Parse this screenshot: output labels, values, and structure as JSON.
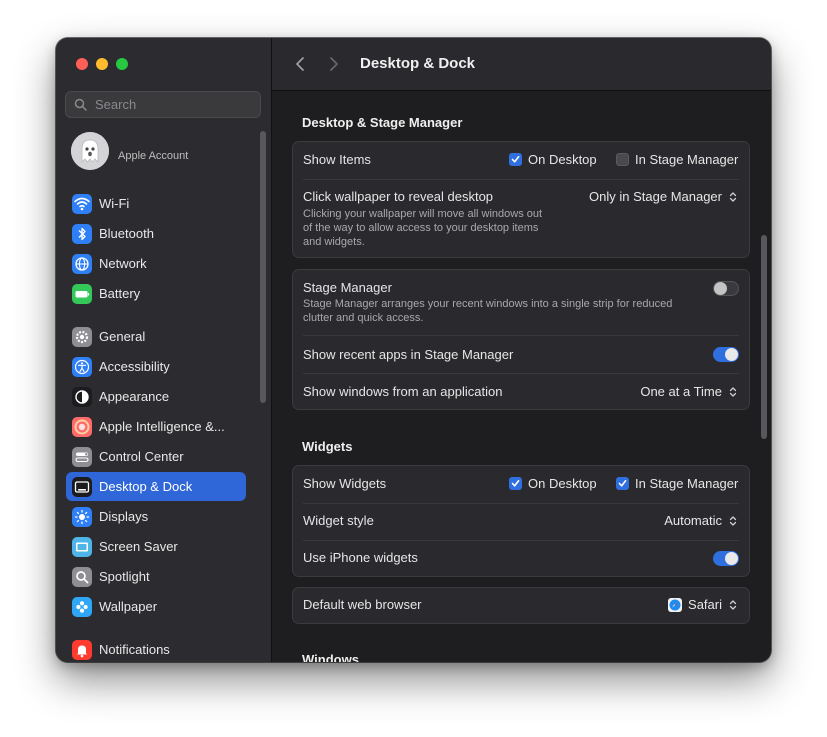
{
  "sidebar": {
    "search_placeholder": "Search",
    "account_label": "Apple Account",
    "items": [
      {
        "label": "Wi-Fi",
        "icon": "wifi-icon",
        "color": "#2f7ff6"
      },
      {
        "label": "Bluetooth",
        "icon": "bluetooth-icon",
        "color": "#2f7ff6"
      },
      {
        "label": "Network",
        "icon": "globe-icon",
        "color": "#2f7ff6"
      },
      {
        "label": "Battery",
        "icon": "battery-icon",
        "color": "#34c759"
      },
      {
        "label": "General",
        "icon": "gear-icon",
        "color": "#8e8e93"
      },
      {
        "label": "Accessibility",
        "icon": "accessibility-icon",
        "color": "#2f7ff6"
      },
      {
        "label": "Appearance",
        "icon": "appearance-icon",
        "color": "#1c1c1e"
      },
      {
        "label": "Apple Intelligence &...",
        "icon": "apple-intelligence-icon",
        "color": "#ff6b6b"
      },
      {
        "label": "Control Center",
        "icon": "control-center-icon",
        "color": "#8e8e93"
      },
      {
        "label": "Desktop & Dock",
        "icon": "desktop-dock-icon",
        "color": "#1c1c1e",
        "active": true
      },
      {
        "label": "Displays",
        "icon": "displays-icon",
        "color": "#2f7ff6"
      },
      {
        "label": "Screen Saver",
        "icon": "screen-saver-icon",
        "color": "#4fb4e8"
      },
      {
        "label": "Spotlight",
        "icon": "spotlight-icon",
        "color": "#8e8e93"
      },
      {
        "label": "Wallpaper",
        "icon": "wallpaper-icon",
        "color": "#2fa7f6"
      },
      {
        "label": "Notifications",
        "icon": "notifications-icon",
        "color": "#ff3b30"
      }
    ]
  },
  "header": {
    "title": "Desktop & Dock"
  },
  "sections": {
    "desktop_stage": {
      "title": "Desktop & Stage Manager",
      "show_items": {
        "label": "Show Items",
        "on_desktop": {
          "label": "On Desktop",
          "checked": true
        },
        "in_stage_manager": {
          "label": "In Stage Manager",
          "checked": false
        }
      },
      "click_wallpaper": {
        "label": "Click wallpaper to reveal desktop",
        "value": "Only in Stage Manager",
        "desc_line1": "Clicking your wallpaper will move all windows out",
        "desc_line2": "of the way to allow access to your desktop items",
        "desc_line3": "and widgets."
      },
      "stage_manager": {
        "label": "Stage Manager",
        "enabled": false,
        "desc_line1": "Stage Manager arranges your recent windows into a single strip for reduced",
        "desc_line2": "clutter and quick access."
      },
      "recent_apps": {
        "label": "Show recent apps in Stage Manager",
        "enabled": true
      },
      "windows_from_app": {
        "label": "Show windows from an application",
        "value": "One at a Time"
      }
    },
    "widgets": {
      "title": "Widgets",
      "show_widgets": {
        "label": "Show Widgets",
        "on_desktop": {
          "label": "On Desktop",
          "checked": true
        },
        "in_stage_manager": {
          "label": "In Stage Manager",
          "checked": true
        }
      },
      "widget_style": {
        "label": "Widget style",
        "value": "Automatic"
      },
      "iphone_widgets": {
        "label": "Use iPhone widgets",
        "enabled": true
      }
    },
    "browser": {
      "label": "Default web browser",
      "value": "Safari"
    },
    "windows": {
      "title": "Windows"
    }
  },
  "colors": {
    "accent": "#2f6fe0",
    "sidebar_active": "#2f67d8"
  }
}
